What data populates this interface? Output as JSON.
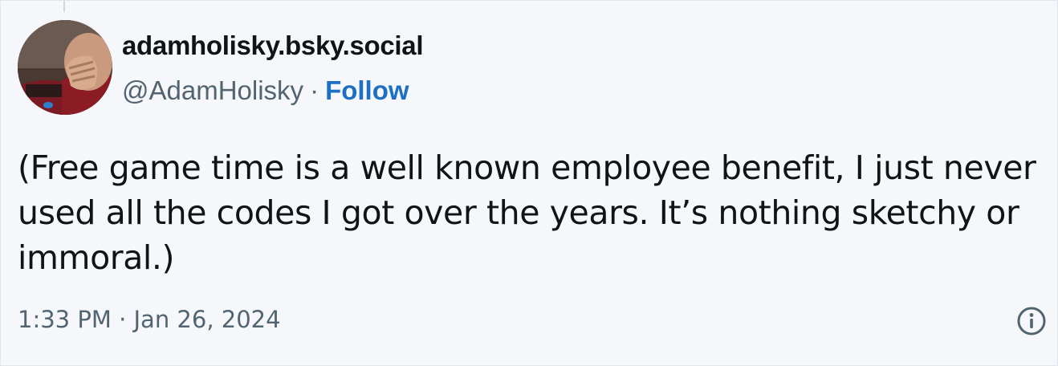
{
  "post": {
    "author": {
      "display_name": "adamholisky.bsky.social",
      "handle": "@AdamHolisky",
      "separator": "·",
      "follow_label": "Follow",
      "avatar_icon": "avatar-image"
    },
    "text": "(Free game time is a well known employee benefit, I just never used all the codes I got over the years. It’s nothing sketchy or immoral.)",
    "timestamp": "1:33 PM · Jan 26, 2024",
    "info_icon": "info-icon"
  },
  "colors": {
    "background": "#f5f7fb",
    "text": "#0f1419",
    "secondary": "#536471",
    "link": "#1d6fc4"
  }
}
